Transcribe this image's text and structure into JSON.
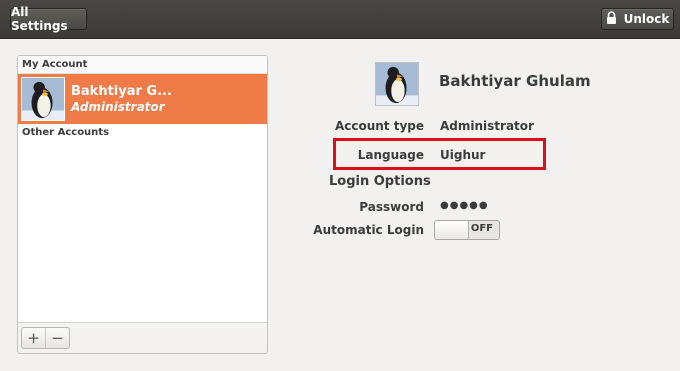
{
  "toolbar": {
    "all_settings_label": "All Settings",
    "unlock_label": "Unlock"
  },
  "accounts_panel": {
    "my_account_header": "My Account",
    "selected_account": {
      "name": "Bakhtiyar G...",
      "role": "Administrator"
    },
    "other_accounts_header": "Other Accounts",
    "add_label": "+",
    "remove_label": "−"
  },
  "details": {
    "user_name": "Bakhtiyar Ghulam",
    "account_type_label": "Account type",
    "account_type_value": "Administrator",
    "language_label": "Language",
    "language_value": "Uighur",
    "login_options_title": "Login Options",
    "password_label": "Password",
    "password_value": "●●●●●",
    "automatic_login_label": "Automatic Login",
    "automatic_login_state": "OFF"
  },
  "colors": {
    "selection_orange": "#ef7b49",
    "highlight_red": "#d8101a",
    "toolbar_dark": "#3c3b37"
  },
  "icons": [
    "padlock-icon",
    "penguin-avatar",
    "plus-icon",
    "minus-icon"
  ]
}
